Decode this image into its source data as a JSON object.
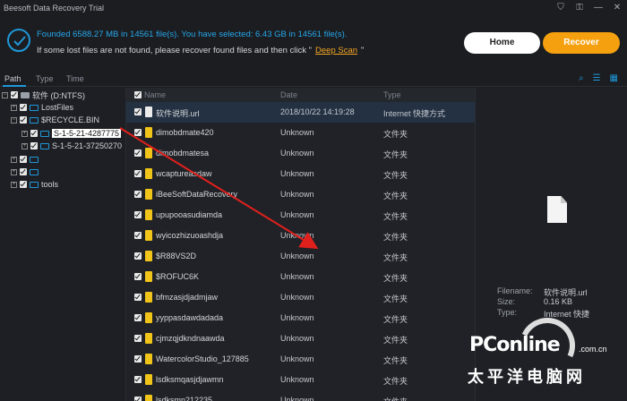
{
  "window": {
    "title": "Beesoft Data Recovery Trial",
    "controls": [
      "⛉",
      "⚿",
      "—",
      "✕"
    ]
  },
  "info": {
    "found_text": "Founded 6588.27 MB in 14561 file(s).   You have selected: 6.43 GB in 14561 file(s).",
    "hint_prefix": "If some lost files are not found, please recover found files and then click \"",
    "deep_scan": "Deep Scan",
    "hint_suffix": "\"",
    "home_label": "Home",
    "recover_label": "Recover"
  },
  "tabs": [
    "Path",
    "Type",
    "Time"
  ],
  "tree": {
    "drive": "软件 (D:NTFS)",
    "lostfiles": "LostFiles",
    "recycle": "$RECYCLE.BIN",
    "sid1": "S-1-5-21-4287775",
    "sid2": "S-1-5-21-37250270",
    "tools": "tools"
  },
  "list": {
    "columns": {
      "name": "Name",
      "date": "Date",
      "type": "Type"
    },
    "rows": [
      {
        "name": "软件说明.url",
        "date": "2018/10/22 14:19:28",
        "type": "Internet 快捷方式",
        "icon": "doc"
      },
      {
        "name": "dimobdmate420",
        "date": "Unknown",
        "type": "文件夹",
        "icon": "folder"
      },
      {
        "name": "dimobdmatesa",
        "date": "Unknown",
        "type": "文件夹",
        "icon": "folder"
      },
      {
        "name": "wcaptureasdaw",
        "date": "Unknown",
        "type": "文件夹",
        "icon": "folder"
      },
      {
        "name": "iBeeSoftDataRecovery",
        "date": "Unknown",
        "type": "文件夹",
        "icon": "folder"
      },
      {
        "name": "upupooasudiamda",
        "date": "Unknown",
        "type": "文件夹",
        "icon": "folder"
      },
      {
        "name": "wyicozhizuoashdja",
        "date": "Unknown",
        "type": "文件夹",
        "icon": "folder"
      },
      {
        "name": "$R88VS2D",
        "date": "Unknown",
        "type": "文件夹",
        "icon": "folder"
      },
      {
        "name": "$ROFUC6K",
        "date": "Unknown",
        "type": "文件夹",
        "icon": "folder"
      },
      {
        "name": "bfmzasjdjadmjaw",
        "date": "Unknown",
        "type": "文件夹",
        "icon": "folder"
      },
      {
        "name": "yyppasdawdadada",
        "date": "Unknown",
        "type": "文件夹",
        "icon": "folder"
      },
      {
        "name": "cjmzqjdkndnaawda",
        "date": "Unknown",
        "type": "文件夹",
        "icon": "folder"
      },
      {
        "name": "WatercolorStudio_127885",
        "date": "Unknown",
        "type": "文件夹",
        "icon": "folder"
      },
      {
        "name": "lsdksmqasjdjawmn",
        "date": "Unknown",
        "type": "文件夹",
        "icon": "folder"
      },
      {
        "name": "lsdksmn212235",
        "date": "Unknown",
        "type": "文件夹",
        "icon": "folder"
      }
    ]
  },
  "preview": {
    "filename_label": "Filename:",
    "filename_value": "软件说明.url",
    "size_label": "Size:",
    "size_value": "0.16 KB",
    "type_label": "Type:",
    "type_value": "Internet 快捷"
  },
  "watermark": {
    "logo": "PConline",
    "com": ".com.cn",
    "cn": "太平洋电脑网"
  },
  "colors": {
    "accent": "#1f98d8",
    "recover": "#f5a00f",
    "arrow": "#e0201c"
  }
}
